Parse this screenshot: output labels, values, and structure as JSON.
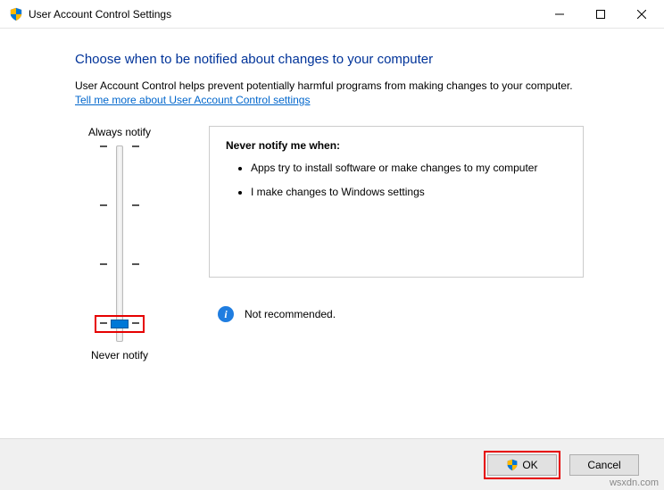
{
  "window": {
    "title": "User Account Control Settings"
  },
  "heading": "Choose when to be notified about changes to your computer",
  "subtext": "User Account Control helps prevent potentially harmful programs from making changes to your computer.",
  "link": "Tell me more about User Account Control settings",
  "slider": {
    "top_label": "Always notify",
    "bottom_label": "Never notify"
  },
  "description": {
    "title": "Never notify me when:",
    "bullets": [
      "Apps try to install software or make changes to my computer",
      "I make changes to Windows settings"
    ]
  },
  "recommendation": "Not recommended.",
  "buttons": {
    "ok": "OK",
    "cancel": "Cancel"
  },
  "watermark": "wsxdn.com"
}
